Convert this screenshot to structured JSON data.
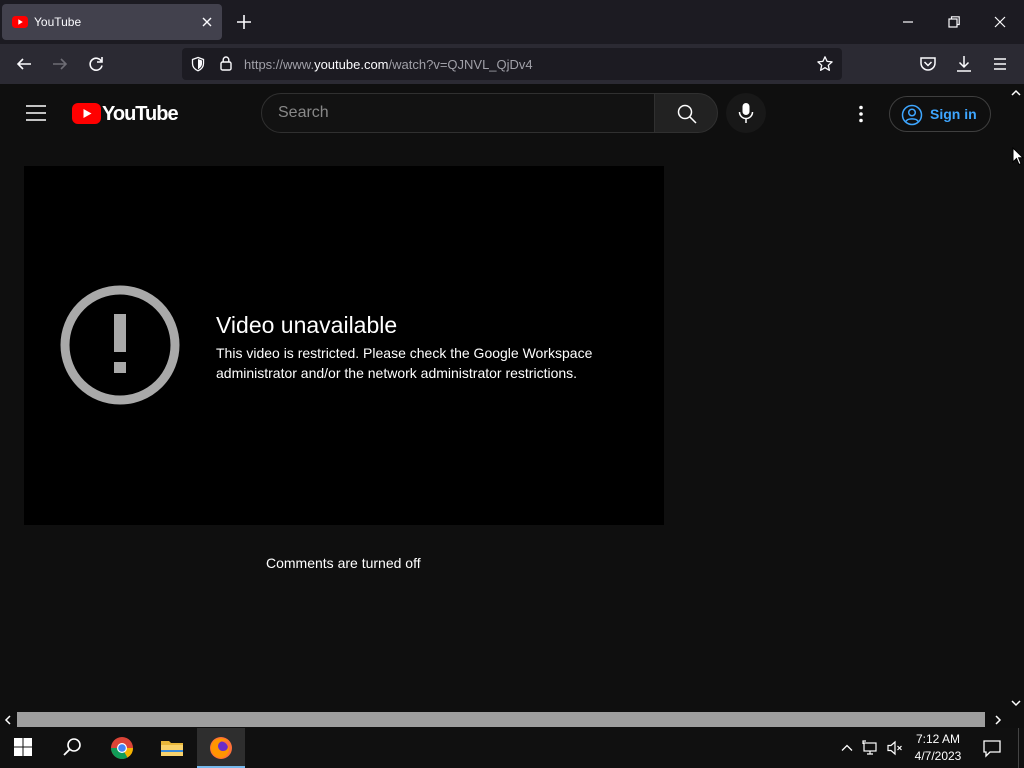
{
  "browser": {
    "tab_title": "YouTube",
    "url_prefix": "https://www.",
    "url_host": "youtube.com",
    "url_path": "/watch?v=QJNVL_QjDv4"
  },
  "youtube": {
    "logo_text": "YouTube",
    "search_placeholder": "Search",
    "sign_in_label": "Sign in",
    "brand_color": "#ff0000",
    "link_color": "#3ea6ff"
  },
  "video": {
    "error_title": "Video unavailable",
    "error_message": "This video is restricted. Please check the Google Workspace administrator and/or the network administrator restrictions."
  },
  "comments": {
    "status_text": "Comments are turned off"
  },
  "taskbar": {
    "time": "7:12 AM",
    "date": "4/7/2023"
  }
}
